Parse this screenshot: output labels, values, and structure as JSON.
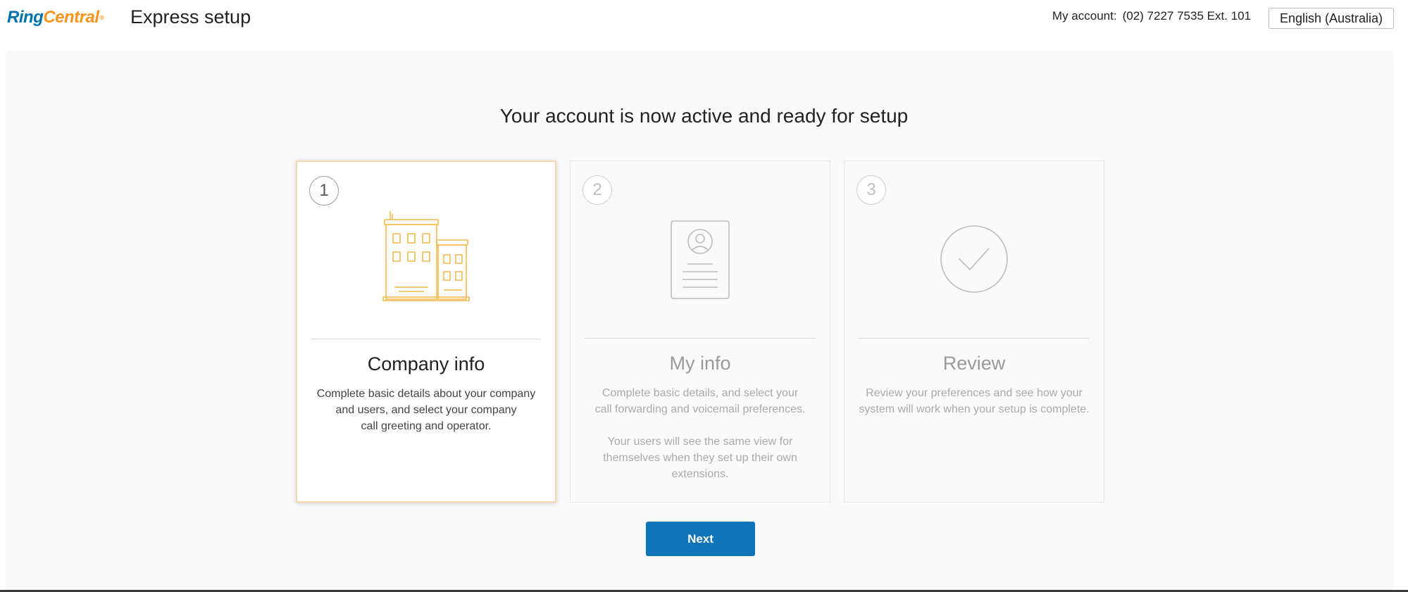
{
  "header": {
    "logo": {
      "ring": "Ring",
      "central": "Central",
      "mark": "®"
    },
    "app_title": "Express setup",
    "account_label": "My account:",
    "account_value": "(02) 7227 7535 Ext. 101",
    "language": "English (Australia)"
  },
  "main": {
    "headline": "Your account is now active and ready for setup",
    "steps": [
      {
        "number": "1",
        "title": "Company info",
        "icon": "building-icon",
        "description": "Complete basic details about your company\nand users, and select your company\ncall greeting and operator.",
        "active": true
      },
      {
        "number": "2",
        "title": "My info",
        "icon": "profile-card-icon",
        "description": "Complete basic details, and select your\ncall forwarding and voicemail preferences.\n\nYour users will see the same view for\nthemselves when they set up their own\nextensions.",
        "active": false
      },
      {
        "number": "3",
        "title": "Review",
        "icon": "checkmark-circle-icon",
        "description": "Review your preferences and see how your\nsystem will work when your setup is complete.",
        "active": false
      }
    ],
    "next_label": "Next"
  },
  "colors": {
    "brand_blue": "#0073ae",
    "brand_orange": "#f7941d",
    "button_blue": "#0f74b8",
    "active_icon": "#f2b94a",
    "inactive_icon": "#bdbdbd"
  }
}
